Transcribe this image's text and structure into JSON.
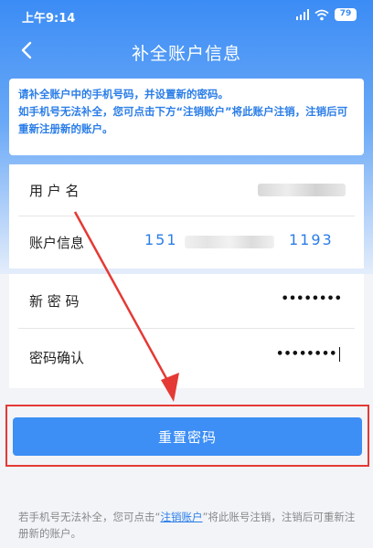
{
  "status_bar": {
    "time": "上午9:14",
    "battery": "79"
  },
  "nav": {
    "title": "补全账户信息"
  },
  "notice": {
    "line1": "请补全账户中的手机号码，并设置新的密码。",
    "line2": "如手机号无法补全，您可点击下方“注销账户”将此账户注销，注销后可重新注册新的账户。"
  },
  "form": {
    "username_label": "用 户 名",
    "account_label": "账户信息",
    "phone_prefix": "151",
    "phone_suffix": "1193",
    "new_password_label": "新 密 码",
    "new_password_value": "••••••••",
    "confirm_label": "密码确认",
    "confirm_value": "••••••••"
  },
  "reset_button": {
    "label": "重置密码"
  },
  "footer": {
    "text_before": "若手机号无法补全，您可点击“",
    "link": "注销账户",
    "text_after": "”将此账号注销，注销后可重新注册新的账户。"
  },
  "colors": {
    "accent": "#3d8ff5",
    "highlight": "#e53935"
  }
}
